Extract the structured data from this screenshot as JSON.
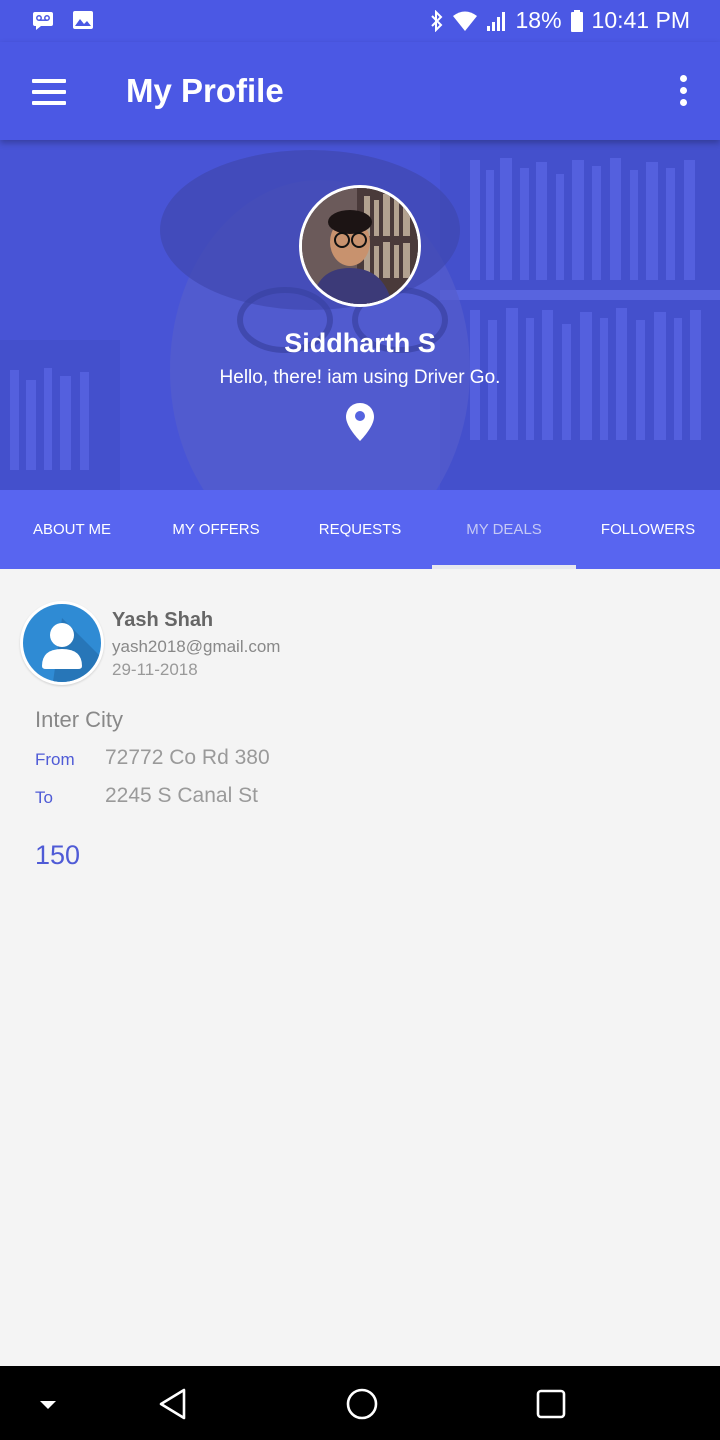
{
  "status_bar": {
    "battery": "18%",
    "time": "10:41 PM",
    "left_icons": [
      "voicemail-icon",
      "image-icon"
    ],
    "right_icons": [
      "bluetooth-icon",
      "wifi-icon",
      "signal-icon",
      "battery-icon"
    ]
  },
  "app_bar": {
    "title": "My Profile"
  },
  "profile": {
    "name": "Siddharth S",
    "status": "Hello, there! iam using Driver Go."
  },
  "tabs": [
    {
      "label": "ABOUT ME",
      "active": false
    },
    {
      "label": "MY OFFERS",
      "active": false
    },
    {
      "label": "REQUESTS",
      "active": false
    },
    {
      "label": "MY DEALS",
      "active": true
    },
    {
      "label": "FOLLOWERS",
      "active": false
    }
  ],
  "deal": {
    "user_name": "Yash Shah",
    "email": "yash2018@gmail.com",
    "date": "29-11-2018",
    "trip_type": "Inter City",
    "from_label": "From",
    "from_value": "72772 Co Rd 380",
    "to_label": "To",
    "to_value": "2245 S Canal St",
    "price": "150"
  },
  "colors": {
    "primary": "#4b58e4",
    "tab_bar": "#5865f0",
    "accent_text": "#4f5bd6",
    "avatar_bg": "#2f8bd4"
  }
}
